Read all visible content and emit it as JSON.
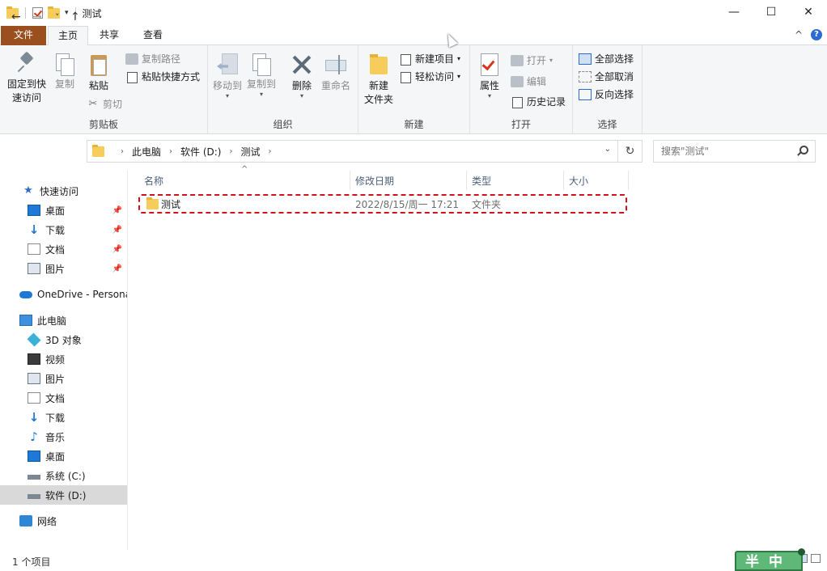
{
  "window": {
    "title": "测试",
    "qa_dropdown": "▾",
    "controls": {
      "minimize": "—",
      "maximize": "☐",
      "close": "✕"
    }
  },
  "ribbon_tabs": {
    "file": "文件",
    "home": "主页",
    "share": "共享",
    "view": "查看"
  },
  "ribbon": {
    "collapse": "^",
    "help": "?",
    "clipboard": {
      "label": "剪贴板",
      "pin": "固定到快速访问",
      "pin_line1": "固定到快",
      "pin_line2": "速访问",
      "copy": "复制",
      "paste": "粘贴",
      "copy_path": "复制路径",
      "paste_shortcut": "粘贴快捷方式",
      "cut": "剪切"
    },
    "organize": {
      "label": "组织",
      "move_to": "移动到",
      "copy_to": "复制到",
      "delete": "删除",
      "rename": "重命名"
    },
    "new": {
      "label": "新建",
      "new_folder_line1": "新建",
      "new_folder_line2": "文件夹",
      "new_item": "新建项目",
      "easy_access": "轻松访问"
    },
    "open": {
      "label": "打开",
      "properties": "属性",
      "open": "打开",
      "edit": "编辑",
      "history": "历史记录"
    },
    "select": {
      "label": "选择",
      "select_all": "全部选择",
      "select_none": "全部取消",
      "invert": "反向选择"
    }
  },
  "nav": {
    "back": "←",
    "forward": "→",
    "recent": "˅",
    "up": "↑",
    "breadcrumb": [
      "此电脑",
      "软件 (D:)",
      "测试"
    ],
    "refresh": "↻",
    "search_placeholder": "搜索\"测试\""
  },
  "sidebar": {
    "quick_access": "快速访问",
    "quick_items": [
      {
        "label": "桌面",
        "icon": "desktop-icon"
      },
      {
        "label": "下载",
        "icon": "download-icon"
      },
      {
        "label": "文档",
        "icon": "document-icon"
      },
      {
        "label": "图片",
        "icon": "pictures-icon"
      }
    ],
    "onedrive": "OneDrive - Persona",
    "this_pc": "此电脑",
    "pc_items": [
      {
        "label": "3D 对象",
        "icon": "3d-objects-icon"
      },
      {
        "label": "视频",
        "icon": "video-icon"
      },
      {
        "label": "图片",
        "icon": "pictures-icon"
      },
      {
        "label": "文档",
        "icon": "document-icon"
      },
      {
        "label": "下载",
        "icon": "download-icon"
      },
      {
        "label": "音乐",
        "icon": "music-icon"
      },
      {
        "label": "桌面",
        "icon": "desktop-icon"
      },
      {
        "label": "系统 (C:)",
        "icon": "drive-icon"
      },
      {
        "label": "软件 (D:)",
        "icon": "drive-icon",
        "selected": true
      }
    ],
    "network": "网络"
  },
  "columns": {
    "name": "名称",
    "modified": "修改日期",
    "type": "类型",
    "size": "大小"
  },
  "files": [
    {
      "name": "测试",
      "modified": "2022/8/15/周一 17:21",
      "type": "文件夹",
      "size": ""
    }
  ],
  "status": {
    "count": "1 个项目"
  },
  "ime": {
    "text": "半中"
  }
}
